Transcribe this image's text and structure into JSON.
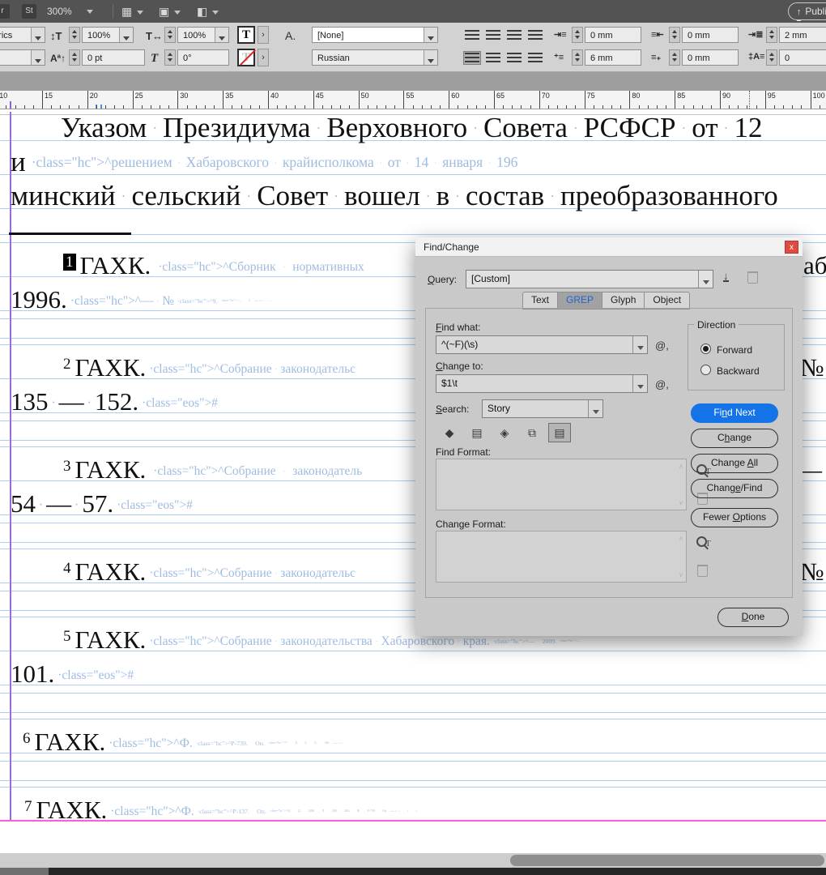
{
  "top_bar": {
    "partial_icon": "r",
    "stock_icon": "St",
    "zoom_level": "300%",
    "publish_label": "Publi"
  },
  "control_panel": {
    "kerning_value": "etrics",
    "vertical_scale": "100%",
    "horizontal_scale": "100%",
    "baseline_shift": "0 pt",
    "skew": "0°",
    "char_style": "[None]",
    "language": "Russian",
    "left_indent": "0 mm",
    "right_indent": "0 mm",
    "space_before": "2 mm",
    "first_line_indent": "6 mm",
    "space_after": "0 mm",
    "drop_cap_lines": "0"
  },
  "ruler": {
    "labels": [
      10,
      15,
      20,
      25,
      30,
      35,
      40,
      45,
      50,
      55,
      60,
      65,
      70,
      75,
      80,
      85,
      90,
      95,
      100
    ]
  },
  "document": {
    "body_lines": [
      "Указом Президиума Верховного Совета РСФСР от 12",
      "и^решением Хабаровского крайисполкома от 14 января 196",
      "минский сельский Совет вошел в состав преобразованного"
    ],
    "footnotes": [
      {
        "num": "1",
        "line1": "ГАХК.^Сборник нормативных",
        "line2": "1996.^— №^9.^— С.^7.#",
        "fragment": "аб"
      },
      {
        "num": "2",
        "line1": "ГАХК.^Собрание законодательс",
        "line2": "135 — 152.#",
        "fragment": "№^"
      },
      {
        "num": "3",
        "line1": "ГАХК.^Собрание законодатель",
        "line2": "54 — 57.#",
        "fragment": "— "
      },
      {
        "num": "4",
        "line1": "ГАХК.^Собрание законодательс",
        "fragment": "№^"
      },
      {
        "num": "5",
        "line1": "ГАХК.^Собрание законодательства Хабаровского края.^— 2009.^—",
        "line2": "101.#"
      },
      {
        "num": "6",
        "line1": "ГАХК.^Ф.^Р-739. Оп.^7. Д. 2. Л. 146.#"
      },
      {
        "num": "7",
        "line1": "ГАХК.^Ф.^Р-137. Оп.^14. Д. 1286. Л. 200, 204; Ф. Р-739. Оп.^7. Д. 13."
      }
    ]
  },
  "dialog": {
    "title": "Find/Change",
    "query_label": "Query:",
    "query_value": "[Custom]",
    "tabs": [
      "Text",
      "GREP",
      "Glyph",
      "Object"
    ],
    "active_tab": "GREP",
    "find_what_label": "Find what:",
    "find_what_value": "^(~F)(\\s)",
    "change_to_label": "Change to:",
    "change_to_value": "$1\\t",
    "search_label": "Search:",
    "search_value": "Story",
    "at_menu": "@",
    "direction_label": "Direction",
    "forward_label": "Forward",
    "backward_label": "Backward",
    "find_format_label": "Find Format:",
    "change_format_label": "Change Format:",
    "find_next_label": "Find Next",
    "change_label": "Change",
    "change_all_label": "Change All",
    "change_find_label": "Change/Find",
    "fewer_options_label": "Fewer Options",
    "done_label": "Done"
  }
}
